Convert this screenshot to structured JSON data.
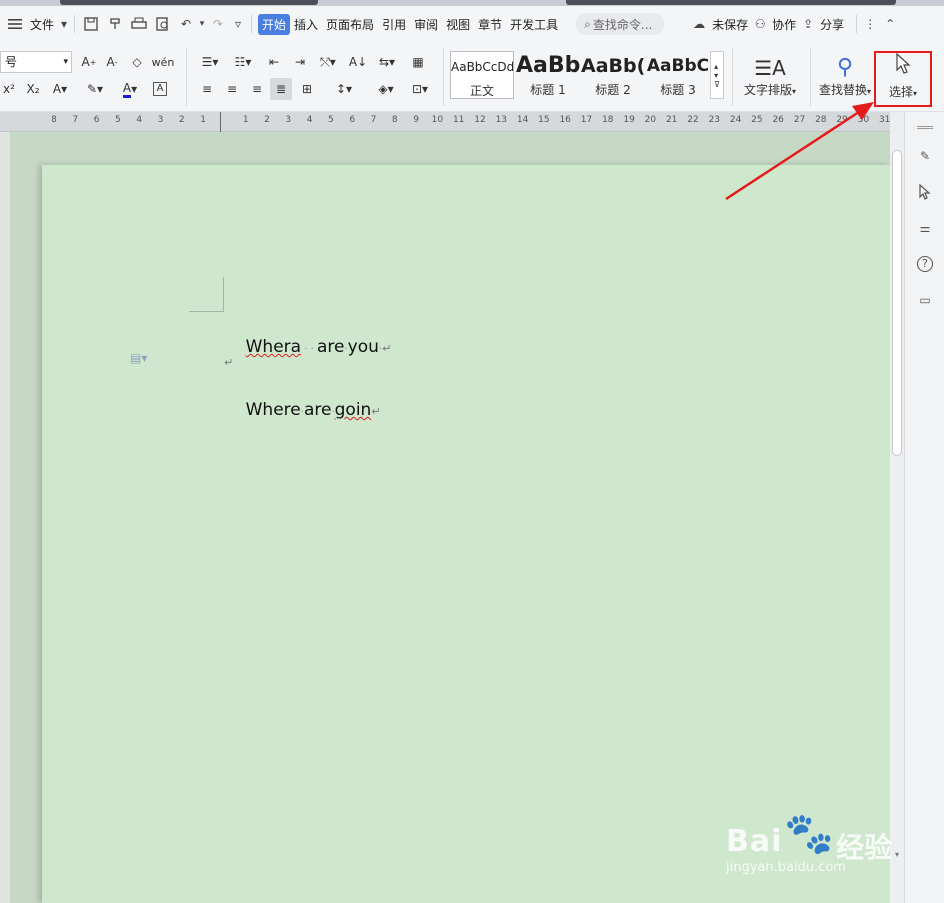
{
  "menubar": {
    "file_label": "文件",
    "tabs": [
      "开始",
      "插入",
      "页面布局",
      "引用",
      "审阅",
      "视图",
      "章节",
      "开发工具"
    ],
    "search_placeholder": "查找命令...",
    "unsaved_label": "未保存",
    "collab_label": "协作",
    "share_label": "分享"
  },
  "ribbon": {
    "font_size_value": "号",
    "styles": [
      {
        "preview": "AaBbCcDd",
        "name": "正文"
      },
      {
        "preview": "AaBb",
        "name": "标题 1"
      },
      {
        "preview": "AaBb(",
        "name": "标题 2"
      },
      {
        "preview": "AaBbC",
        "name": "标题 3"
      }
    ],
    "text_layout_label": "文字排版",
    "find_replace_label": "查找替换",
    "select_label": "选择"
  },
  "ruler": {
    "ticks": [
      "8",
      "7",
      "6",
      "5",
      "4",
      "3",
      "2",
      "1",
      "",
      "1",
      "2",
      "3",
      "4",
      "5",
      "6",
      "7",
      "8",
      "9",
      "10",
      "11",
      "12",
      "13",
      "14",
      "15",
      "16",
      "17",
      "18",
      "19",
      "20",
      "21",
      "22",
      "23",
      "24",
      "25",
      "26",
      "27",
      "28",
      "29",
      "30",
      "31"
    ]
  },
  "document": {
    "line1_word1": "Whera",
    "line1_rest": "are",
    "line1_word3": "you",
    "line3_a": "Where",
    "line3_b": "are",
    "line3_c": "goin"
  },
  "watermark": {
    "brand": "Bai",
    "brand_suffix": "经验",
    "url": "jingyan.baidu.com"
  },
  "colors": {
    "accent": "#4a7ee0",
    "highlight": "#e31b1b",
    "page_bg": "#cee7cd"
  }
}
